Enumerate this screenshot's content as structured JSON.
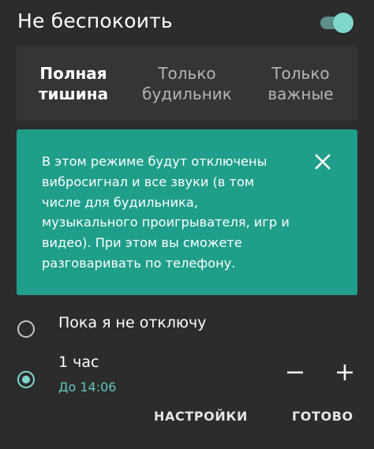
{
  "header": {
    "title": "Не беспокоить",
    "toggle_on": true
  },
  "modes": [
    {
      "label": "Полная\nтишина",
      "active": true
    },
    {
      "label": "Только\nбудильник",
      "active": false
    },
    {
      "label": "Только\nважные",
      "active": false
    }
  ],
  "info": {
    "text": "В этом режиме будут отключены вибросигнал и все звуки (в том числе для будильника, музыкального проигрывателя, игр и видео). При этом вы сможете разговаривать по телефону."
  },
  "options": [
    {
      "label": "Пока я не отключу",
      "selected": false
    },
    {
      "label": "1 час",
      "sub": "До 14:06",
      "selected": true
    }
  ],
  "actions": {
    "settings": "НАСТРОЙКИ",
    "done": "ГОТОВО"
  },
  "colors": {
    "background": "#2c2c2c",
    "card": "#1f9e8a",
    "accent": "#7fd6cd",
    "subtext": "#5fc7ba"
  },
  "icons": {
    "close": "close-icon",
    "minus": "minus-icon",
    "plus": "plus-icon"
  }
}
